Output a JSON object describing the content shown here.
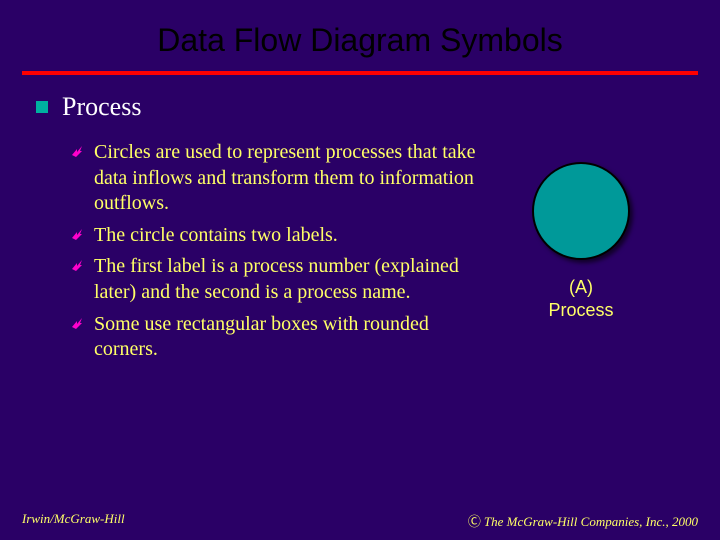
{
  "title": "Data Flow Diagram Symbols",
  "heading": "Process",
  "bullets": [
    "Circles are used to represent processes that take data inflows and transform them to information outflows.",
    "The circle contains two labels.",
    "The first label is a process number (explained later) and the second is a process name.",
    "Some use rectangular boxes with rounded corners."
  ],
  "figure": {
    "label_line1": "(A)",
    "label_line2": "Process"
  },
  "footer": {
    "left": "Irwin/McGraw-Hill",
    "right_symbol": "Ⓒ",
    "right_text": "The McGraw-Hill Companies, Inc., 2000"
  }
}
